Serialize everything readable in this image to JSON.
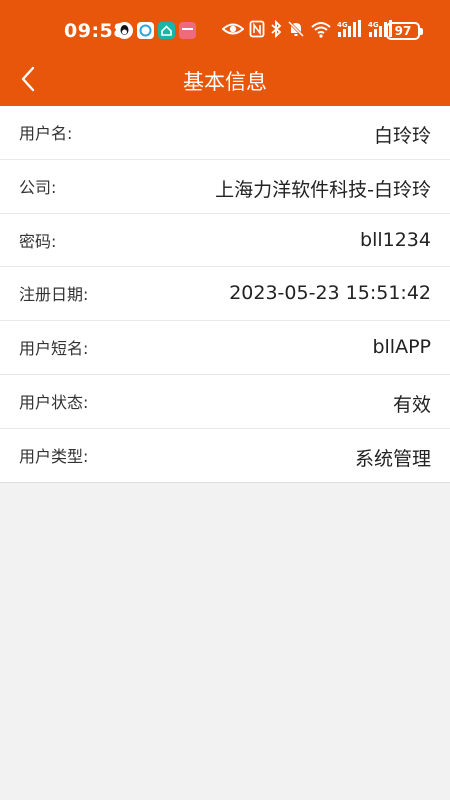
{
  "status_bar": {
    "time": "09:58",
    "battery": "97",
    "notification_icons": [
      "qq-icon",
      "chat-bubble-icon",
      "home-app-icon",
      "calendar-app-icon"
    ],
    "system_icons": [
      "eye-icon",
      "nfc-icon",
      "bluetooth-icon",
      "mute-bell-icon",
      "wifi-icon",
      "signal-4g-icon",
      "signal-4g-icon"
    ]
  },
  "header": {
    "title": "基本信息",
    "background_color": "#e8560c"
  },
  "info_rows": [
    {
      "label": "用户名:",
      "value": "白玲玲"
    },
    {
      "label": "公司:",
      "value": "上海力洋软件科技-白玲玲"
    },
    {
      "label": "密码:",
      "value": "bll1234"
    },
    {
      "label": "注册日期:",
      "value": "2023-05-23 15:51:42"
    },
    {
      "label": "用户短名:",
      "value": "bllAPP"
    },
    {
      "label": "用户状态:",
      "value": "有效"
    },
    {
      "label": "用户类型:",
      "value": "系统管理"
    }
  ]
}
